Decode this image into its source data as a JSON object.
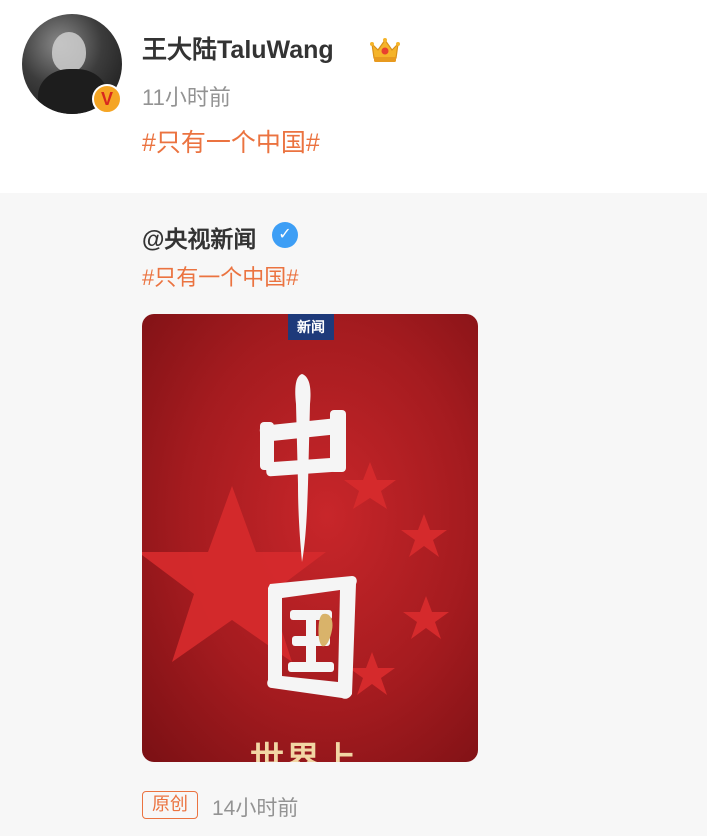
{
  "post": {
    "username": "王大陆TaluWang",
    "verified_badge": "V",
    "crown_icon": "crown-icon",
    "time": "11小时前",
    "hashtag": "#只有一个中国#"
  },
  "repost": {
    "author": "@央视新闻",
    "verified_icon": "✓",
    "hashtag": "#只有一个中国#",
    "image": {
      "news_label": "新闻",
      "title_chars": [
        "中",
        "国"
      ],
      "bottom_text": "世界上"
    },
    "original_badge": "原创",
    "time": "14小时前"
  },
  "colors": {
    "accent": "#eb7340",
    "text_primary": "#333333",
    "text_secondary": "#939393",
    "verified_blue": "#3d9ef5",
    "badge_gold": "#f5a524",
    "poster_red": "#c8262a"
  }
}
